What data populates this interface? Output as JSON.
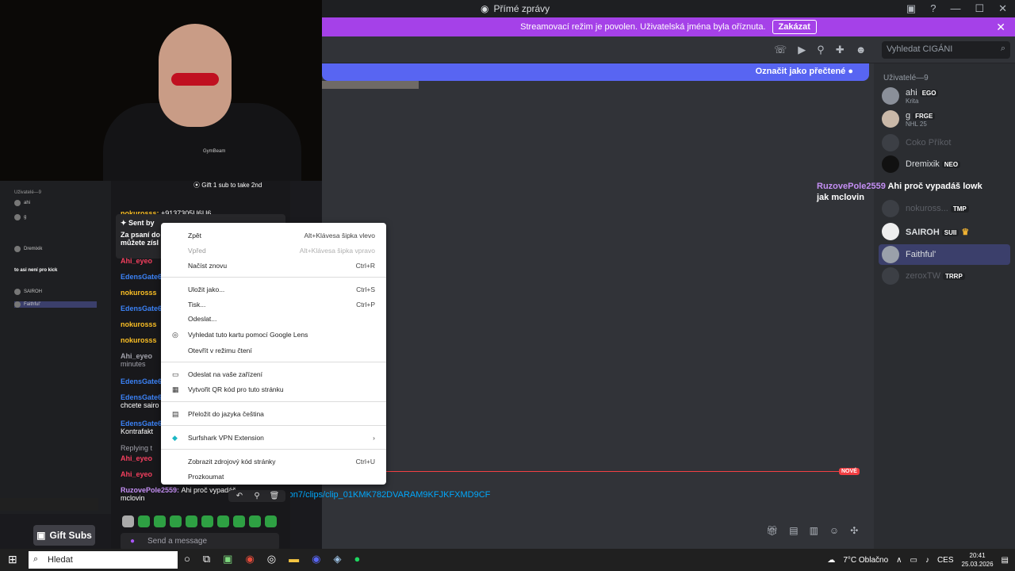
{
  "discord": {
    "title": "Přímé zprávy",
    "banner_text": "Streamovací režim je povolen. Uživatelská jména byla oříznuta.",
    "banner_button": "Zakázat",
    "search_placeholder": "Vyhledat CIGÁNI",
    "mark_read": "Označit jako přečtené",
    "new_badge": "NOVÉ",
    "link_text": "ron7/clips/clip_01KMK782DVARAM9KFJKFXMD9CF",
    "members_header": "Uživatelé—9",
    "members": [
      {
        "name": "ahi",
        "tag": "EGO",
        "sub": "Krita"
      },
      {
        "name": "g",
        "tag": "FRGE",
        "sub": "NHL 25"
      },
      {
        "name": "Coko Příkot",
        "tag": "",
        "sub": ""
      },
      {
        "name": "Dremixik",
        "tag": "NEO",
        "sub": ""
      },
      {
        "name": "nokuross...",
        "tag": "TMP",
        "sub": ""
      },
      {
        "name": "SAIROH",
        "tag": "SUII",
        "sub": ""
      },
      {
        "name": "Faithful'",
        "tag": "",
        "sub": ""
      },
      {
        "name": "zeroxTW",
        "tag": "TRRP",
        "sub": ""
      }
    ],
    "overlay_user": "RuzovePole2559",
    "overlay_message": "Ahi proč vypadáš lowk jak mclovin"
  },
  "kick": {
    "gift_text": "Gift 1 sub to take 2nd",
    "pinned_sent_by": "Sent by",
    "pinned_text": "Za psaní do\nmůžete zísl",
    "messages": [
      {
        "user": "nokurosss",
        "color": "orange",
        "text": "+9137305U6U6"
      },
      {
        "user": "Ahi_eyeo",
        "color": "red",
        "text": ""
      },
      {
        "user": "EdensGate6",
        "color": "blue",
        "text": ""
      },
      {
        "user": "nokurosss",
        "color": "orange",
        "text": ""
      },
      {
        "user": "EdensGate6",
        "color": "blue",
        "text": ""
      },
      {
        "user": "nokurosss",
        "color": "orange",
        "text": ""
      },
      {
        "user": "nokurosss",
        "color": "orange",
        "text": ""
      },
      {
        "user": "Ahi_eyeo",
        "color": "white",
        "text": "minutes"
      },
      {
        "user": "EdensGate6",
        "color": "blue",
        "text": ""
      },
      {
        "user": "EdensGate6",
        "color": "blue",
        "text": "chcete sairo"
      },
      {
        "user": "EdensGate6",
        "color": "blue",
        "text": "Kontrafakt"
      },
      {
        "user": "Replying t",
        "color": "white",
        "text": ""
      },
      {
        "user": "Ahi_eyeo",
        "color": "red",
        "text": ""
      },
      {
        "user": "Ahi_eyeo",
        "color": "red",
        "text": ""
      }
    ],
    "last_user": "RuzovePole2559:",
    "last_text": "Ahi proč vypadáš",
    "last_text2": "mclovin",
    "send_placeholder": "Send a message",
    "gift_subs": "Gift Subs",
    "left_text": "to asi není pro kick"
  },
  "context_menu": [
    {
      "label": "Zpět",
      "shortcut": "Alt+Klávesa šipka vlevo",
      "disabled": false,
      "icon": ""
    },
    {
      "label": "Vpřed",
      "shortcut": "Alt+Klávesa šipka vpravo",
      "disabled": true,
      "icon": ""
    },
    {
      "label": "Načíst znovu",
      "shortcut": "Ctrl+R",
      "disabled": false,
      "icon": ""
    },
    {
      "label": "Uložit jako...",
      "shortcut": "Ctrl+S",
      "disabled": false,
      "icon": ""
    },
    {
      "label": "Tisk...",
      "shortcut": "Ctrl+P",
      "disabled": false,
      "icon": ""
    },
    {
      "label": "Odeslat...",
      "shortcut": "",
      "disabled": false,
      "icon": ""
    },
    {
      "label": "Vyhledat tuto kartu pomocí Google Lens",
      "shortcut": "",
      "disabled": false,
      "icon": "lens-icon"
    },
    {
      "label": "Otevřít v režimu čtení",
      "shortcut": "",
      "disabled": false,
      "icon": ""
    },
    {
      "label": "Odeslat na vaše zařízení",
      "shortcut": "",
      "disabled": false,
      "icon": "device-icon"
    },
    {
      "label": "Vytvořit QR kód pro tuto stránku",
      "shortcut": "",
      "disabled": false,
      "icon": "qr-icon"
    },
    {
      "label": "Přeložit do jazyka čeština",
      "shortcut": "",
      "disabled": false,
      "icon": "translate-icon"
    },
    {
      "label": "Surfshark VPN Extension",
      "shortcut": "›",
      "disabled": false,
      "icon": "surfshark-icon"
    },
    {
      "label": "Zobrazit zdrojový kód stránky",
      "shortcut": "Ctrl+U",
      "disabled": false,
      "icon": ""
    },
    {
      "label": "Prozkoumat",
      "shortcut": "",
      "disabled": false,
      "icon": ""
    }
  ],
  "taskbar": {
    "search": "Hledat",
    "weather": "7°C  Oblačno",
    "lang": "CES",
    "time": "20:41",
    "date": "25.03.2026"
  }
}
